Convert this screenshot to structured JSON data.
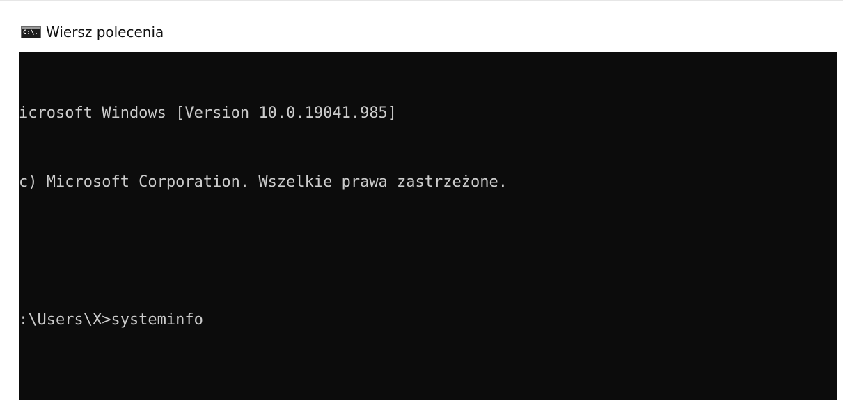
{
  "window": {
    "title": "Wiersz polecenia",
    "icon": "command-prompt-icon",
    "icon_text": "C:\\."
  },
  "console": {
    "background": "#0c0c0c",
    "foreground": "#cccccc",
    "lines": [
      "icrosoft Windows [Version 10.0.19041.985]",
      "c) Microsoft Corporation. Wszelkie prawa zastrzeżone.",
      "",
      ":\\Users\\X>systeminfo"
    ]
  }
}
